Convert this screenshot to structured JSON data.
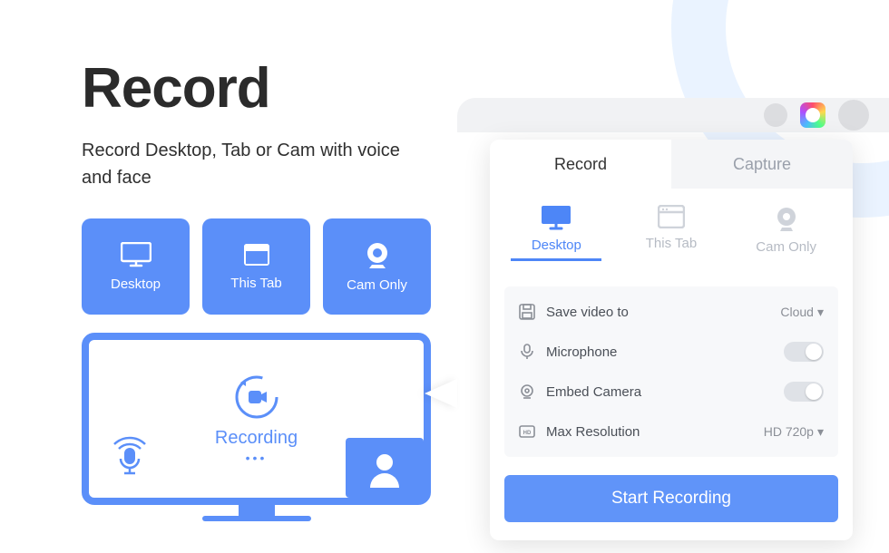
{
  "hero": {
    "title": "Record",
    "subtitle": "Record Desktop, Tab or Cam with voice and face"
  },
  "modes": [
    {
      "label": "Desktop"
    },
    {
      "label": "This Tab"
    },
    {
      "label": "Cam Only"
    }
  ],
  "monitor": {
    "status": "Recording"
  },
  "panel": {
    "tabs": {
      "record": "Record",
      "capture": "Capture"
    },
    "sources": [
      {
        "label": "Desktop"
      },
      {
        "label": "This Tab"
      },
      {
        "label": "Cam Only"
      }
    ],
    "settings": {
      "save": {
        "label": "Save video to",
        "value": "Cloud"
      },
      "mic": {
        "label": "Microphone"
      },
      "camera": {
        "label": "Embed Camera"
      },
      "resolution": {
        "label": "Max Resolution",
        "value": "HD 720p"
      }
    },
    "start_label": "Start Recording"
  }
}
